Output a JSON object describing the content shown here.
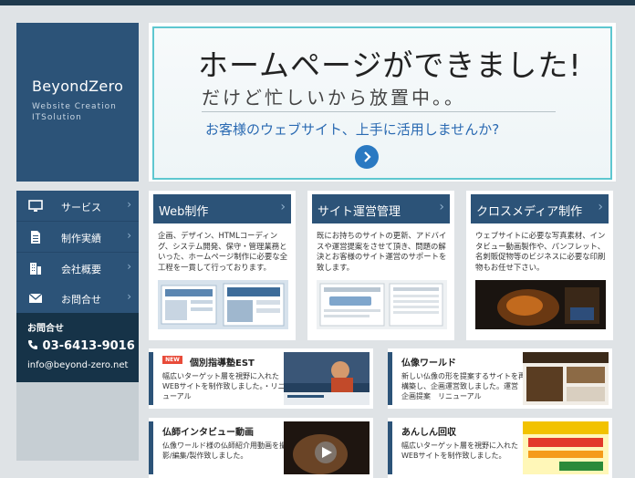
{
  "logo": {
    "name": "BeyondZero",
    "tagline_1": "Website  Creation",
    "tagline_2": "ITSolution"
  },
  "hero": {
    "headline": "ホームページができました!",
    "subheadline": "だけど忙しいから放置中。。",
    "cta": "お客様のウェブサイト、上手に活用しませんか?"
  },
  "nav": {
    "items": [
      {
        "label": "サービス",
        "icon": "monitor-icon"
      },
      {
        "label": "制作実績",
        "icon": "document-icon"
      },
      {
        "label": "会社概要",
        "icon": "building-icon"
      },
      {
        "label": "お問合せ",
        "icon": "mail-icon"
      }
    ]
  },
  "contact": {
    "title": "お問合せ",
    "tel": "03-6413-9016",
    "email": "info@beyond-zero.net"
  },
  "cards": [
    {
      "title": "Web制作",
      "desc": "企画、デザイン、HTMLコーディング、システム開発、保守・管理業務といった、ホームページ制作に必要な全工程を一貫して行っております。"
    },
    {
      "title": "サイト運営管理",
      "desc": "既にお持ちのサイトの更新、アドバイスや運営提案をさせて頂き、問題の解決とお客様のサイト運営のサポートを致します。"
    },
    {
      "title": "クロスメディア制作",
      "desc": "ウェブサイトに必要な写真素材、インタビュー動画製作や、パンフレット、名刺販促物等のビジネスに必要な印刷物もお任せ下さい。"
    }
  ],
  "news": [
    {
      "badge": "NEW",
      "title": "個別指導塾EST",
      "text": "幅広いターゲット層を視野に入れたWEBサイトを制作致しました。・リニューアル"
    },
    {
      "badge": "",
      "title": "仏像ワールド",
      "text": "新しい仏像の形を提案するサイトを再構築し、企画運営致しました。運営　企画提案　リニューアル"
    },
    {
      "badge": "",
      "title": "仏師インタビュー動画",
      "text": "仏像ワールド様の仏師紹介用動画を撮影/編集/製作致しました。"
    },
    {
      "badge": "",
      "title": "あんしん回収",
      "text": "幅広いターゲット層を視野に入れたWEBサイトを制作致しました。"
    }
  ],
  "colors": {
    "navy": "#2c5378",
    "dark_navy": "#163348",
    "accent_cyan": "#5ec7d0",
    "cta_blue": "#2a6ab2",
    "badge_red": "#e84b3a"
  }
}
